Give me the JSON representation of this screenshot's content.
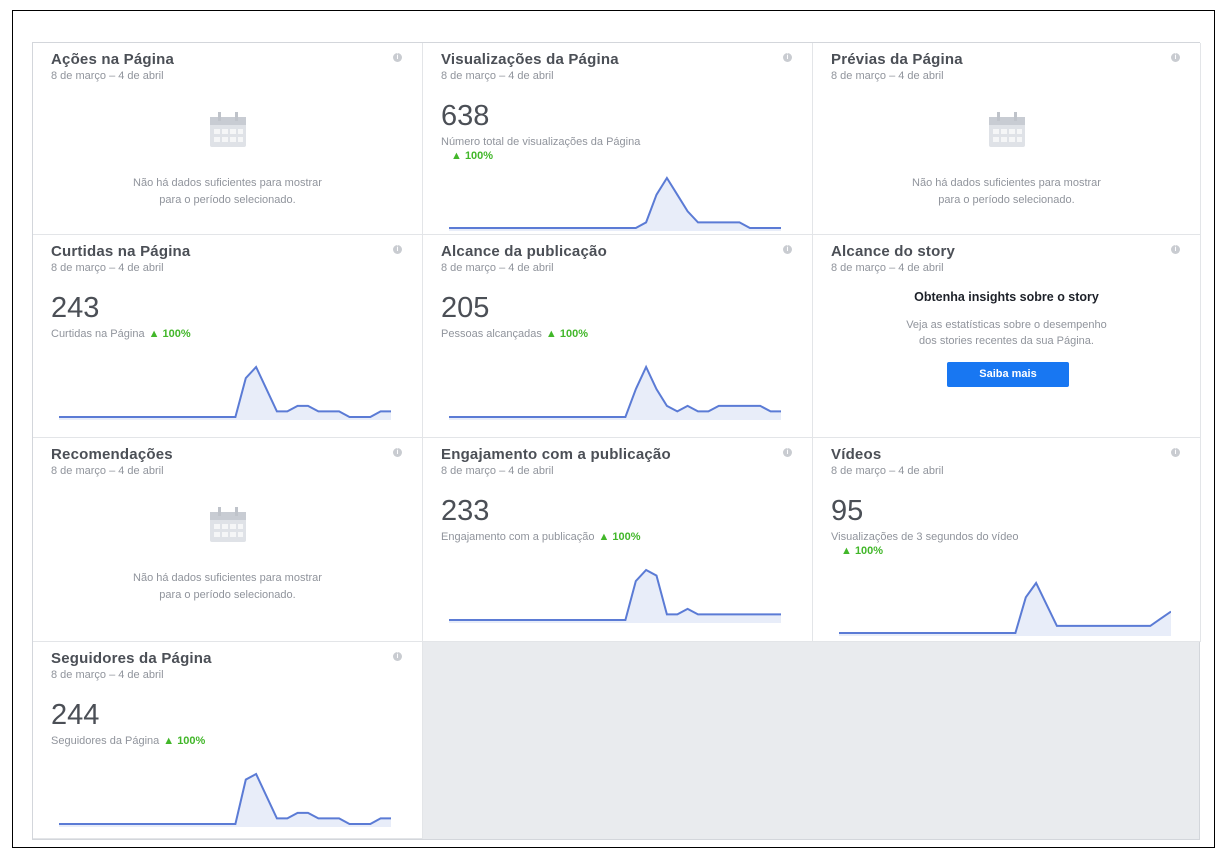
{
  "cards": {
    "acoes": {
      "title": "Ações na Página",
      "date": "8 de março – 4 de abril",
      "empty_line1": "Não há dados suficientes para mostrar",
      "empty_line2": "para o período selecionado."
    },
    "visualizacoes": {
      "title": "Visualizações da Página",
      "date": "8 de março – 4 de abril",
      "value": "638",
      "subtitle": "Número total de visualizações da Página",
      "delta": "▲ 100%"
    },
    "previas": {
      "title": "Prévias da Página",
      "date": "8 de março – 4 de abril",
      "empty_line1": "Não há dados suficientes para mostrar",
      "empty_line2": "para o período selecionado."
    },
    "curtidas": {
      "title": "Curtidas na Página",
      "date": "8 de março – 4 de abril",
      "value": "243",
      "subtitle": "Curtidas na Página",
      "delta": "▲ 100%"
    },
    "alcance_pub": {
      "title": "Alcance da publicação",
      "date": "8 de março – 4 de abril",
      "value": "205",
      "subtitle": "Pessoas alcançadas",
      "delta": "▲ 100%"
    },
    "alcance_story": {
      "title": "Alcance do story",
      "date": "8 de março – 4 de abril",
      "heading": "Obtenha insights sobre o story",
      "text_line1": "Veja as estatísticas sobre o desempenho",
      "text_line2": "dos stories recentes da sua Página.",
      "button": "Saiba mais"
    },
    "recomendacoes": {
      "title": "Recomendações",
      "date": "8 de março – 4 de abril",
      "empty_line1": "Não há dados suficientes para mostrar",
      "empty_line2": "para o período selecionado."
    },
    "engajamento": {
      "title": "Engajamento com a publicação",
      "date": "8 de março – 4 de abril",
      "value": "233",
      "subtitle": "Engajamento com a publicação",
      "delta": "▲ 100%"
    },
    "videos": {
      "title": "Vídeos",
      "date": "8 de março – 4 de abril",
      "value": "95",
      "subtitle": "Visualizações de 3 segundos do vídeo",
      "delta": "▲ 100%"
    },
    "seguidores": {
      "title": "Seguidores da Página",
      "date": "8 de março – 4 de abril",
      "value": "244",
      "subtitle": "Seguidores da Página",
      "delta": "▲ 100%"
    }
  },
  "icons": {
    "info": "info-icon",
    "calendar": "calendar-icon"
  },
  "colors": {
    "spark_line": "#5b7bd5",
    "spark_fill": "#e8edf9",
    "delta": "#42b72a",
    "button": "#1877f2"
  },
  "sparklines": {
    "visualizacoes": [
      0,
      0,
      0,
      0,
      0,
      0,
      0,
      0,
      0,
      0,
      0,
      0,
      0,
      0,
      0,
      0,
      0,
      0,
      0,
      1,
      6,
      9,
      6,
      3,
      1,
      1,
      1,
      1,
      1,
      0,
      0,
      0,
      0
    ],
    "curtidas": [
      0,
      0,
      0,
      0,
      0,
      0,
      0,
      0,
      0,
      0,
      0,
      0,
      0,
      0,
      0,
      0,
      0,
      0,
      7,
      9,
      5,
      1,
      1,
      2,
      2,
      1,
      1,
      1,
      0,
      0,
      0,
      1,
      1
    ],
    "alcance_pub": [
      0,
      0,
      0,
      0,
      0,
      0,
      0,
      0,
      0,
      0,
      0,
      0,
      0,
      0,
      0,
      0,
      0,
      0,
      5,
      9,
      5,
      2,
      1,
      2,
      1,
      1,
      2,
      2,
      2,
      2,
      2,
      1,
      1
    ],
    "engajamento": [
      0,
      0,
      0,
      0,
      0,
      0,
      0,
      0,
      0,
      0,
      0,
      0,
      0,
      0,
      0,
      0,
      0,
      0,
      7,
      9,
      8,
      1,
      1,
      2,
      1,
      1,
      1,
      1,
      1,
      1,
      1,
      1,
      1
    ],
    "videos": [
      0,
      0,
      0,
      0,
      0,
      0,
      0,
      0,
      0,
      0,
      0,
      0,
      0,
      0,
      0,
      0,
      0,
      0,
      5,
      7,
      4,
      1,
      1,
      1,
      1,
      1,
      1,
      1,
      1,
      1,
      1,
      2,
      3
    ],
    "seguidores": [
      0,
      0,
      0,
      0,
      0,
      0,
      0,
      0,
      0,
      0,
      0,
      0,
      0,
      0,
      0,
      0,
      0,
      0,
      8,
      9,
      5,
      1,
      1,
      2,
      2,
      1,
      1,
      1,
      0,
      0,
      0,
      1,
      1
    ]
  }
}
